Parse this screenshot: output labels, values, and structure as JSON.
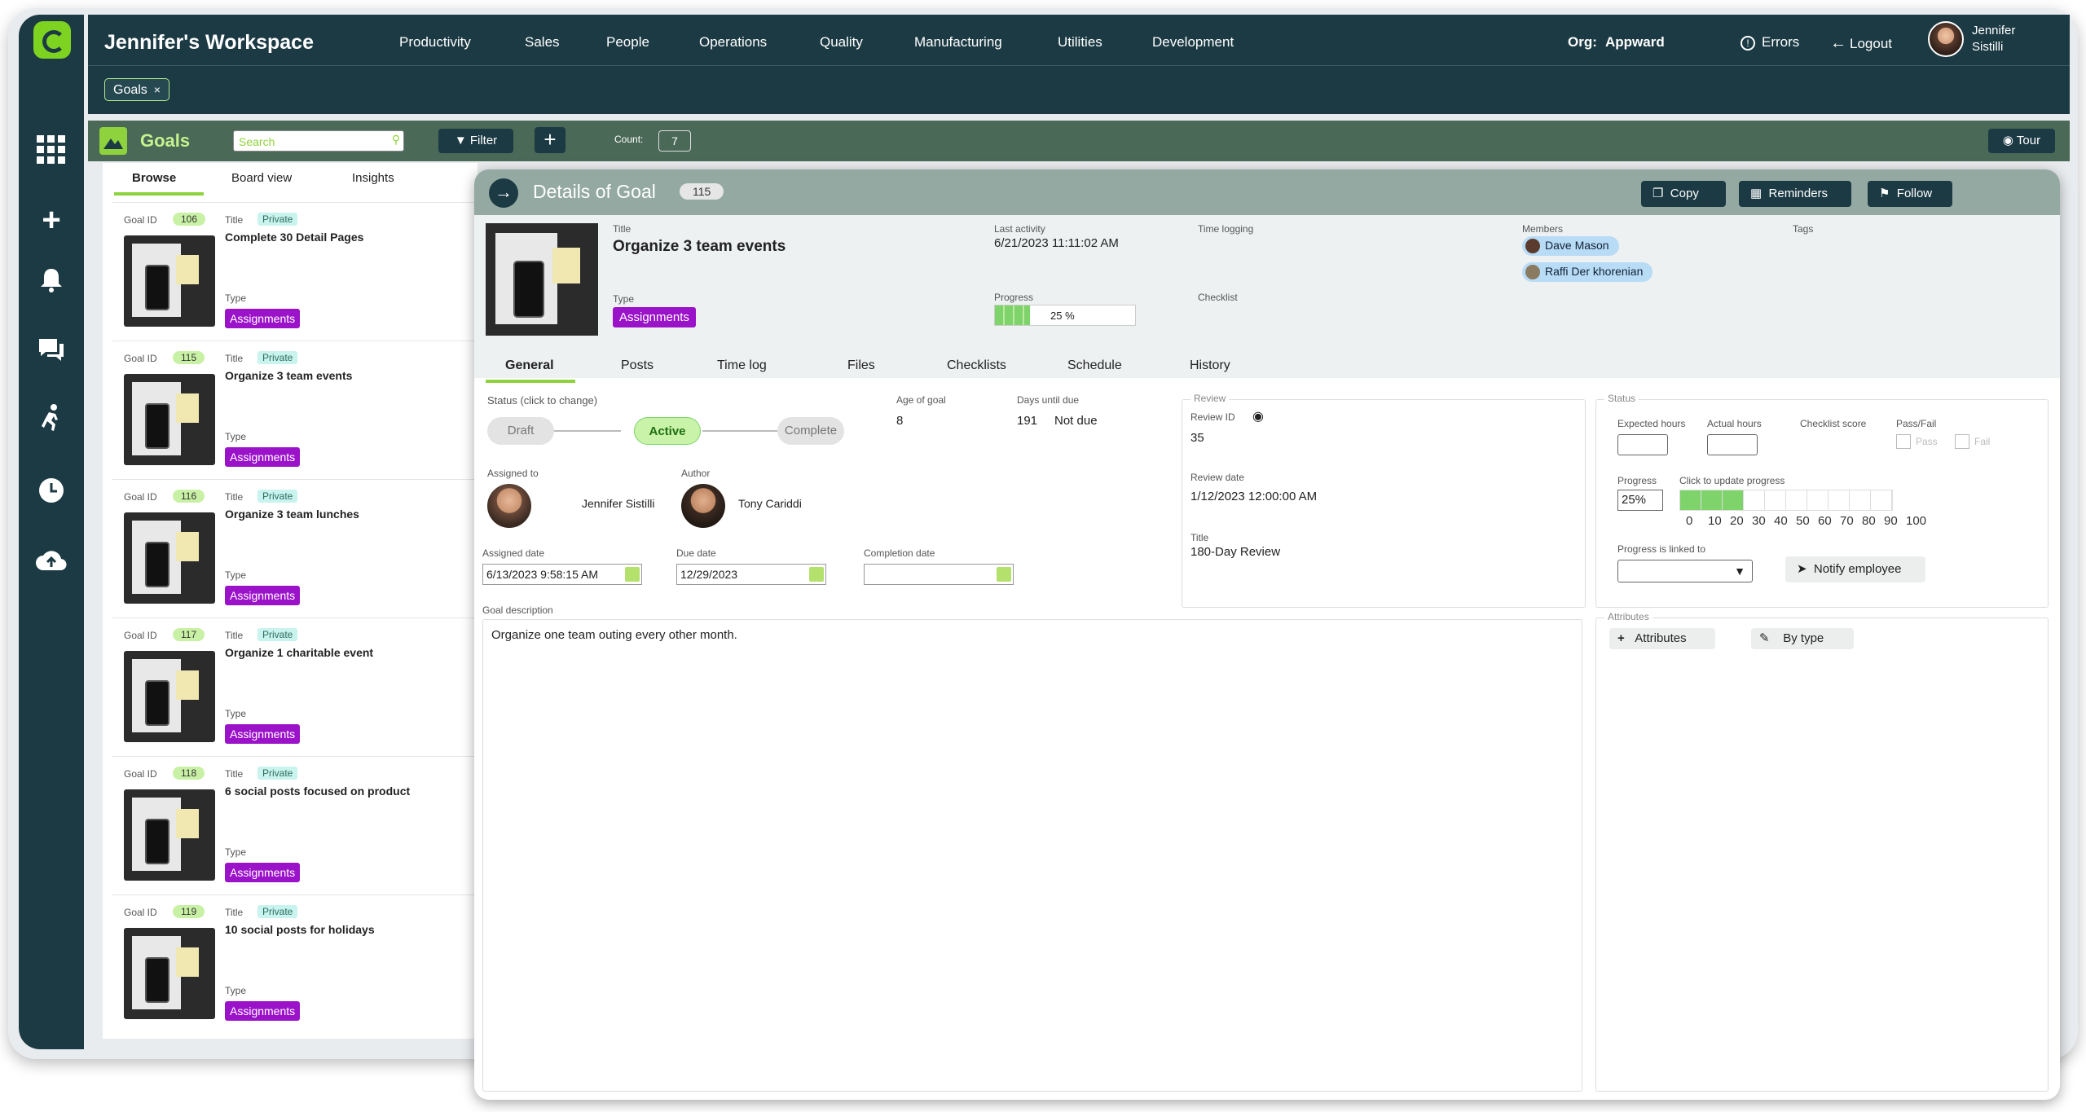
{
  "header": {
    "workspace_title": "Jennifer's Workspace",
    "nav": [
      "Productivity",
      "Sales",
      "People",
      "Operations",
      "Quality",
      "Manufacturing",
      "Utilities",
      "Development"
    ],
    "org_label": "Org:",
    "org_value": "Appward",
    "errors": "Errors",
    "logout": "Logout",
    "user_first": "Jennifer",
    "user_last": "Sistilli"
  },
  "open_tab": {
    "label": "Goals",
    "close": "×"
  },
  "goalbar": {
    "title": "Goals",
    "search_placeholder": "Search",
    "filter": "Filter",
    "count_label": "Count:",
    "count_value": "7",
    "tour": "Tour"
  },
  "list": {
    "tabs": [
      "Browse",
      "Board view",
      "Insights"
    ],
    "goal_id_label": "Goal ID",
    "title_label": "Title",
    "type_label": "Type",
    "private_label": "Private",
    "items": [
      {
        "id": "106",
        "title": "Complete 30 Detail Pages",
        "type": "Assignments"
      },
      {
        "id": "115",
        "title": "Organize 3 team events",
        "type": "Assignments"
      },
      {
        "id": "116",
        "title": "Organize 3 team lunches",
        "type": "Assignments"
      },
      {
        "id": "117",
        "title": "Organize 1 charitable event",
        "type": "Assignments"
      },
      {
        "id": "118",
        "title": "6 social posts focused on product",
        "type": "Assignments"
      },
      {
        "id": "119",
        "title": "10 social posts for holidays",
        "type": "Assignments"
      }
    ]
  },
  "details": {
    "heading": "Details of Goal",
    "goal_id": "115",
    "copy": "Copy",
    "reminders": "Reminders",
    "follow": "Follow",
    "title_label": "Title",
    "title": "Organize 3 team events",
    "type_label": "Type",
    "type": "Assignments",
    "last_activity_label": "Last activity",
    "last_activity": "6/21/2023 11:11:02 AM",
    "progress_label": "Progress",
    "progress_text": "25 %",
    "progress": 25,
    "time_logging_label": "Time logging",
    "checklist_label": "Checklist",
    "members_label": "Members",
    "members": [
      "Dave Mason",
      "Raffi Der khorenian"
    ],
    "tags_label": "Tags",
    "tabs": [
      "General",
      "Posts",
      "Time log",
      "Files",
      "Checklists",
      "Schedule",
      "History"
    ],
    "status_label": "Status (click to change)",
    "status_steps": [
      "Draft",
      "Active",
      "Complete"
    ],
    "age_label": "Age of goal",
    "age": "8",
    "days_due_label": "Days until due",
    "days_due": "191",
    "due_state": "Not due",
    "assigned_to_label": "Assigned to",
    "assigned_to": "Jennifer Sistilli",
    "author_label": "Author",
    "author": "Tony Cariddi",
    "assigned_date_label": "Assigned date",
    "assigned_date": "6/13/2023 9:58:15 AM",
    "due_date_label": "Due date",
    "due_date": "12/29/2023",
    "completion_date_label": "Completion date",
    "completion_date": "",
    "description_label": "Goal description",
    "description": "Organize one team outing every other month.",
    "review": {
      "section": "Review",
      "id_label": "Review ID",
      "id": "35",
      "date_label": "Review date",
      "date": "1/12/2023 12:00:00 AM",
      "title_label": "Title",
      "title": "180-Day Review"
    },
    "status_box": {
      "section": "Status",
      "expected_hours": "Expected hours",
      "actual_hours": "Actual hours",
      "checklist_score": "Checklist score",
      "pass_fail": "Pass/Fail",
      "pass": "Pass",
      "fail": "Fail",
      "progress_label": "Progress",
      "progress_value": "25%",
      "click_update": "Click to update progress",
      "scale": [
        "0",
        "10",
        "20",
        "30",
        "40",
        "50",
        "60",
        "70",
        "80",
        "90",
        "100"
      ],
      "linked_label": "Progress is linked to",
      "notify": "Notify employee"
    },
    "attributes": {
      "section": "Attributes",
      "add": "Attributes",
      "by_type": "By type"
    }
  },
  "colors": {
    "dark": "#1c3a44",
    "accent": "#8ed33d",
    "purple": "#9b13c9",
    "header_gray": "#94a9a2"
  }
}
